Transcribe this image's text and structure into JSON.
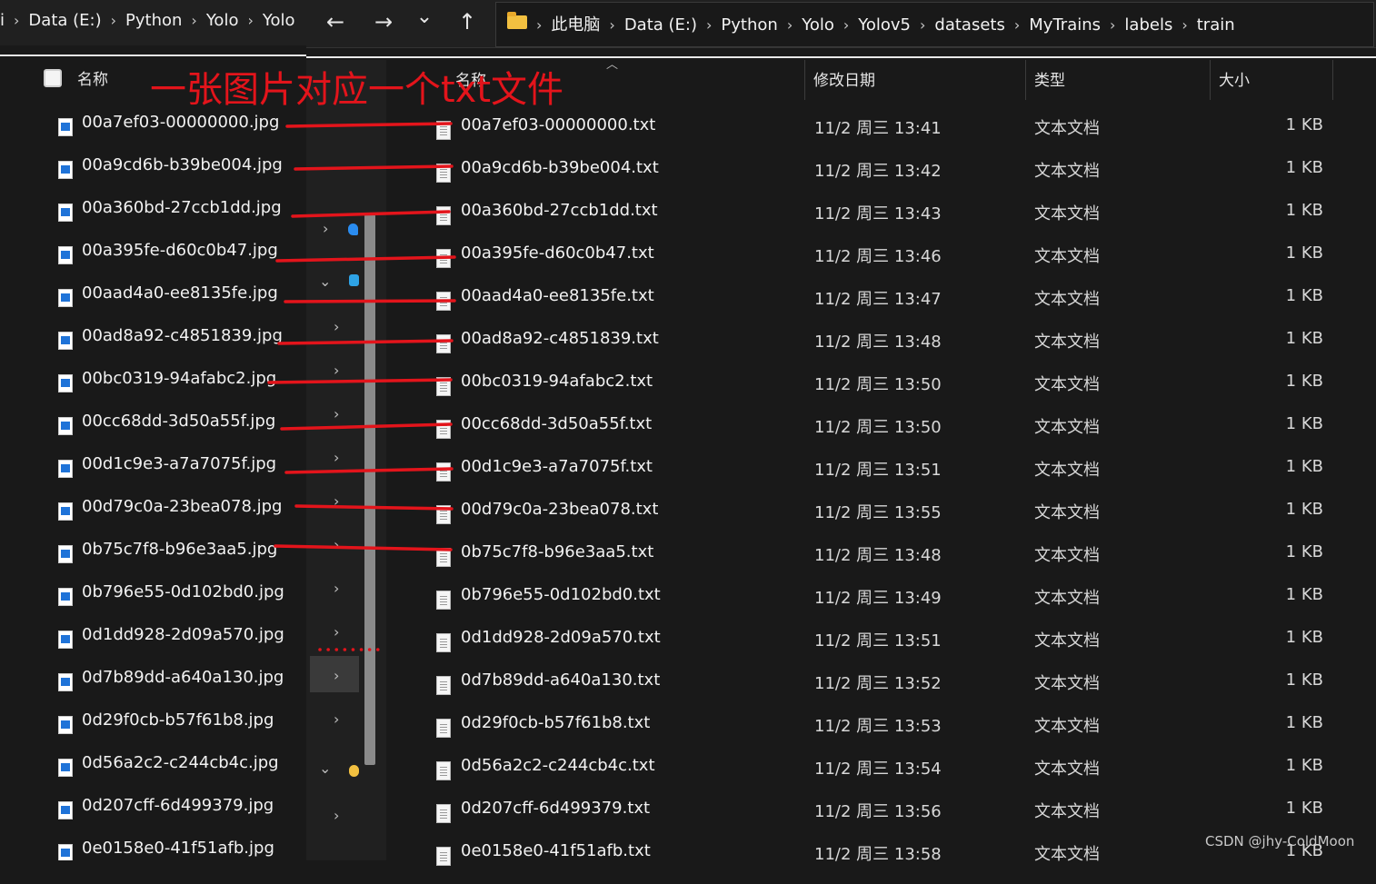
{
  "left_window": {
    "breadcrumb": [
      "i",
      "Data (E:)",
      "Python",
      "Yolo",
      "Yolo"
    ],
    "column_name": "名称",
    "files": [
      "00a7ef03-00000000.jpg",
      "00a9cd6b-b39be004.jpg",
      "00a360bd-27ccb1dd.jpg",
      "00a395fe-d60c0b47.jpg",
      "00aad4a0-ee8135fe.jpg",
      "00ad8a92-c4851839.jpg",
      "00bc0319-94afabc2.jpg",
      "00cc68dd-3d50a55f.jpg",
      "00d1c9e3-a7a7075f.jpg",
      "00d79c0a-23bea078.jpg",
      "0b75c7f8-b96e3aa5.jpg",
      "0b796e55-0d102bd0.jpg",
      "0d1dd928-2d09a570.jpg",
      "0d7b89dd-a640a130.jpg",
      "0d29f0cb-b57f61b8.jpg",
      "0d56a2c2-c244cb4c.jpg",
      "0d207cff-6d499379.jpg",
      "0e0158e0-41f51afb.jpg"
    ]
  },
  "toolbar": {
    "back": "←",
    "forward": "→",
    "recent": "⌄",
    "up": "↑"
  },
  "right_window": {
    "breadcrumb": [
      "此电脑",
      "Data (E:)",
      "Python",
      "Yolo",
      "Yolov5",
      "datasets",
      "MyTrains",
      "labels",
      "train"
    ],
    "columns": {
      "name": "名称",
      "date": "修改日期",
      "type": "类型",
      "size": "大小"
    },
    "rows": [
      {
        "name": "00a7ef03-00000000.txt",
        "date": "11/2 周三 13:41",
        "type": "文本文档",
        "size": "1 KB"
      },
      {
        "name": "00a9cd6b-b39be004.txt",
        "date": "11/2 周三 13:42",
        "type": "文本文档",
        "size": "1 KB"
      },
      {
        "name": "00a360bd-27ccb1dd.txt",
        "date": "11/2 周三 13:43",
        "type": "文本文档",
        "size": "1 KB"
      },
      {
        "name": "00a395fe-d60c0b47.txt",
        "date": "11/2 周三 13:46",
        "type": "文本文档",
        "size": "1 KB"
      },
      {
        "name": "00aad4a0-ee8135fe.txt",
        "date": "11/2 周三 13:47",
        "type": "文本文档",
        "size": "1 KB"
      },
      {
        "name": "00ad8a92-c4851839.txt",
        "date": "11/2 周三 13:48",
        "type": "文本文档",
        "size": "1 KB"
      },
      {
        "name": "00bc0319-94afabc2.txt",
        "date": "11/2 周三 13:50",
        "type": "文本文档",
        "size": "1 KB"
      },
      {
        "name": "00cc68dd-3d50a55f.txt",
        "date": "11/2 周三 13:50",
        "type": "文本文档",
        "size": "1 KB"
      },
      {
        "name": "00d1c9e3-a7a7075f.txt",
        "date": "11/2 周三 13:51",
        "type": "文本文档",
        "size": "1 KB"
      },
      {
        "name": "00d79c0a-23bea078.txt",
        "date": "11/2 周三 13:55",
        "type": "文本文档",
        "size": "1 KB"
      },
      {
        "name": "0b75c7f8-b96e3aa5.txt",
        "date": "11/2 周三 13:48",
        "type": "文本文档",
        "size": "1 KB"
      },
      {
        "name": "0b796e55-0d102bd0.txt",
        "date": "11/2 周三 13:49",
        "type": "文本文档",
        "size": "1 KB"
      },
      {
        "name": "0d1dd928-2d09a570.txt",
        "date": "11/2 周三 13:51",
        "type": "文本文档",
        "size": "1 KB"
      },
      {
        "name": "0d7b89dd-a640a130.txt",
        "date": "11/2 周三 13:52",
        "type": "文本文档",
        "size": "1 KB"
      },
      {
        "name": "0d29f0cb-b57f61b8.txt",
        "date": "11/2 周三 13:53",
        "type": "文本文档",
        "size": "1 KB"
      },
      {
        "name": "0d56a2c2-c244cb4c.txt",
        "date": "11/2 周三 13:54",
        "type": "文本文档",
        "size": "1 KB"
      },
      {
        "name": "0d207cff-6d499379.txt",
        "date": "11/2 周三 13:56",
        "type": "文本文档",
        "size": "1 KB"
      },
      {
        "name": "0e0158e0-41f51afb.txt",
        "date": "11/2 周三 13:58",
        "type": "文本文档",
        "size": "1 KB"
      }
    ]
  },
  "annotation": {
    "text": "一张图片对应一个txt文件",
    "color": "#e3141b"
  },
  "watermark": "CSDN @jhy-ColdMoon"
}
